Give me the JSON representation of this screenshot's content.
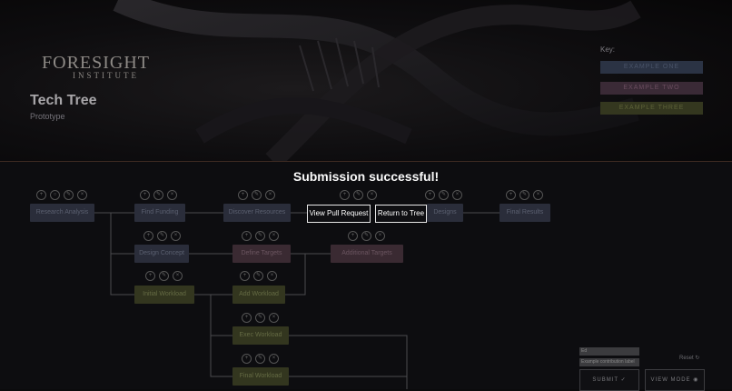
{
  "header": {
    "logo_line1": "FORESIGHT",
    "logo_line2": "INSTITUTE",
    "title": "Tech Tree",
    "subtitle": "Prototype",
    "key_label": "Key:",
    "key_items": [
      "EXAMPLE ONE",
      "EXAMPLE TWO",
      "EXAMPLE THREE"
    ]
  },
  "tree": {
    "nodes": [
      {
        "label": "Research Analysis"
      },
      {
        "label": "Find Funding"
      },
      {
        "label": "Discover Resources"
      },
      {
        "label": "Designs"
      },
      {
        "label": "Final Results"
      },
      {
        "label": "Design Concept"
      },
      {
        "label": "Define Targets"
      },
      {
        "label": "Additional Targets"
      },
      {
        "label": "Initial Workload"
      },
      {
        "label": "Add Workload"
      },
      {
        "label": "Exec Workload"
      },
      {
        "label": "Final Workload"
      }
    ]
  },
  "dialog": {
    "message": "Submission successful!",
    "view_pr_label": "View Pull Request",
    "return_label": "Return to Tree"
  },
  "controls": {
    "input1": "Ed",
    "input2": "Example contribution label",
    "reset_label": "Reset",
    "submit_label": "SUBMIT",
    "view_mode_label": "VIEW MODE"
  }
}
